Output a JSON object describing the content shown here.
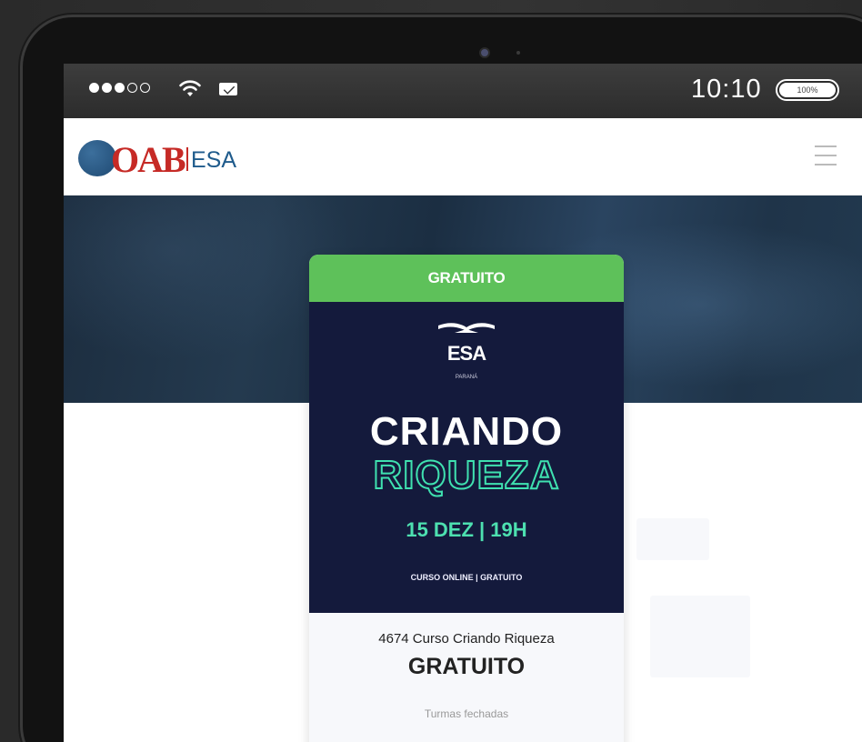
{
  "statusbar": {
    "signal_dots": [
      "full",
      "full",
      "full",
      "empty",
      "empty"
    ],
    "wifi_icon": "wifi-icon",
    "mail_icon": "mail-icon",
    "time": "10:10",
    "battery_text": "100%"
  },
  "header": {
    "logo_main": "OAB",
    "logo_secondary": "ESA",
    "menu_icon": "hamburger-menu-icon"
  },
  "card": {
    "tag": "GRATUITO",
    "banner": {
      "brand": "ESA",
      "brand_sub": "PARANÁ",
      "title_line1": "CRIANDO",
      "title_line2": "RIQUEZA",
      "date": "15 DEZ | 19H",
      "subline": "CURSO ONLINE | GRATUITO"
    },
    "course_name": "4674 Curso Criando Riqueza",
    "price": "GRATUITO",
    "status": "Turmas fechadas"
  },
  "colors": {
    "tag_green": "#5ec15a",
    "banner_navy": "#141a3c",
    "accent_teal": "#4de0b0",
    "oab_red": "#c62a26",
    "esa_blue": "#1f5b8c"
  }
}
